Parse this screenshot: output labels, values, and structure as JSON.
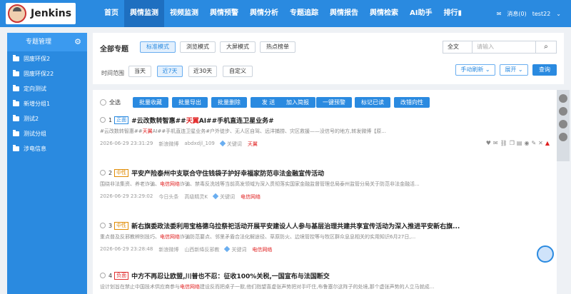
{
  "brand": {
    "name": "Jenkins"
  },
  "nav": [
    "首页",
    "舆情监测",
    "视频监测",
    "舆情预警",
    "舆情分析",
    "专题追踪",
    "舆情报告",
    "舆情检索",
    "AI助手",
    "排行▮"
  ],
  "nav_active": 1,
  "top_right": {
    "message": "消息(0)",
    "user": "test22"
  },
  "sidebar": {
    "title": "专题管理",
    "items": [
      "固废环保2",
      "固废环保22",
      "定向测试",
      "新增分组1",
      "测试2",
      "测试分组",
      "涉电信息"
    ]
  },
  "filter": {
    "title": "全部专题",
    "modes": [
      "标准模式",
      "浏览模式",
      "大屏模式",
      "热点榜单"
    ],
    "search_scope": "全文",
    "search_placeholder": "请输入",
    "time_label": "时间范围",
    "ranges": [
      "当天",
      "近7天",
      "近30天",
      "自定义"
    ],
    "refresh": "手动刷新",
    "expand": "展开",
    "query": "查询"
  },
  "toolbar": {
    "select_all": "全选",
    "buttons": [
      "批量收藏",
      "批量导出",
      "批量删除",
      "发 送",
      "加入简报",
      "一键预警",
      "标记已读",
      "改错向性"
    ]
  },
  "news": [
    {
      "idx": "1",
      "tag": "正面",
      "title_pre": "#云改数转智惠##",
      "title_hl": "天翼",
      "title_post": "AI##手机直连卫星业务#",
      "summary_pre": "#云改数转智惠##",
      "summary_hl": "天翼",
      "summary_post": "AI##手机直连卫星业务#户外徒步、无人区自驾、远洋捕捞、灾区救援——没信号的地方,转发微博【原...",
      "date": "2026-06-29 23:31:29",
      "source": "新浪微博",
      "author": "abdxdjl_109",
      "kw_label": "关键词",
      "keyword": "天翼"
    },
    {
      "idx": "2",
      "tag": "中性",
      "title_pre": "平安产险泰州中支联合守住钱袋子护好幸福家防范非法金融宣传活动",
      "title_hl": "",
      "title_post": "",
      "summary_pre": "围绕非法集资、养老诈骗、",
      "summary_hl": "电信网络",
      "summary_post": "诈骗、禁毒反洗钱等当前高发领域为深入贯彻落实国家金融监督管理总局泰州监管分局关于防范非法金融活...",
      "date": "2026-06-29 23:29:02",
      "source": "今日头条",
      "author": "高级精灵K",
      "kw_label": "关键词",
      "keyword": "电信网络"
    },
    {
      "idx": "3",
      "tag": "中性",
      "title_pre": "新右旗委政法委利用宝格德乌拉祭祀活动开展平安建设人人参与基层治理共建共享宣传活动为深入推进平安新右旗...",
      "title_hl": "",
      "title_post": "",
      "summary_pre": "重点普及反邪教辨别技巧、",
      "summary_hl": "电信网络",
      "summary_post": "诈骗防范要点、邻里矛盾合法化解途径、草原防火、边境管控等与牧区群众息息相关的实用知识6月27日,...",
      "date": "2026-06-29 23:28:48",
      "source": "新浪微博",
      "author": "山西新绛反邪教",
      "kw_label": "关键词",
      "keyword": "电信网络"
    },
    {
      "idx": "4",
      "tag": "负面",
      "title_pre": "中方不再忍让欧盟,川普也不忍：征收100%关税,一国宣布与法国断交",
      "title_hl": "",
      "title_post": "",
      "summary_pre": "设计划旨在禁止中国技术供应商参与",
      "summary_hl": "电信网络",
      "summary_post": "建设反而把桌子一掀,他们指望喜虚张声势把对手吓住,布鲁塞尔这阵子的处境,那个虚张声势的人立马就成...",
      "date": "",
      "source": "",
      "author": "",
      "kw_label": "",
      "keyword": ""
    }
  ],
  "colors": {
    "primary": "#2a8ae0",
    "negative": "#e03030",
    "neutral": "#e08a00"
  }
}
